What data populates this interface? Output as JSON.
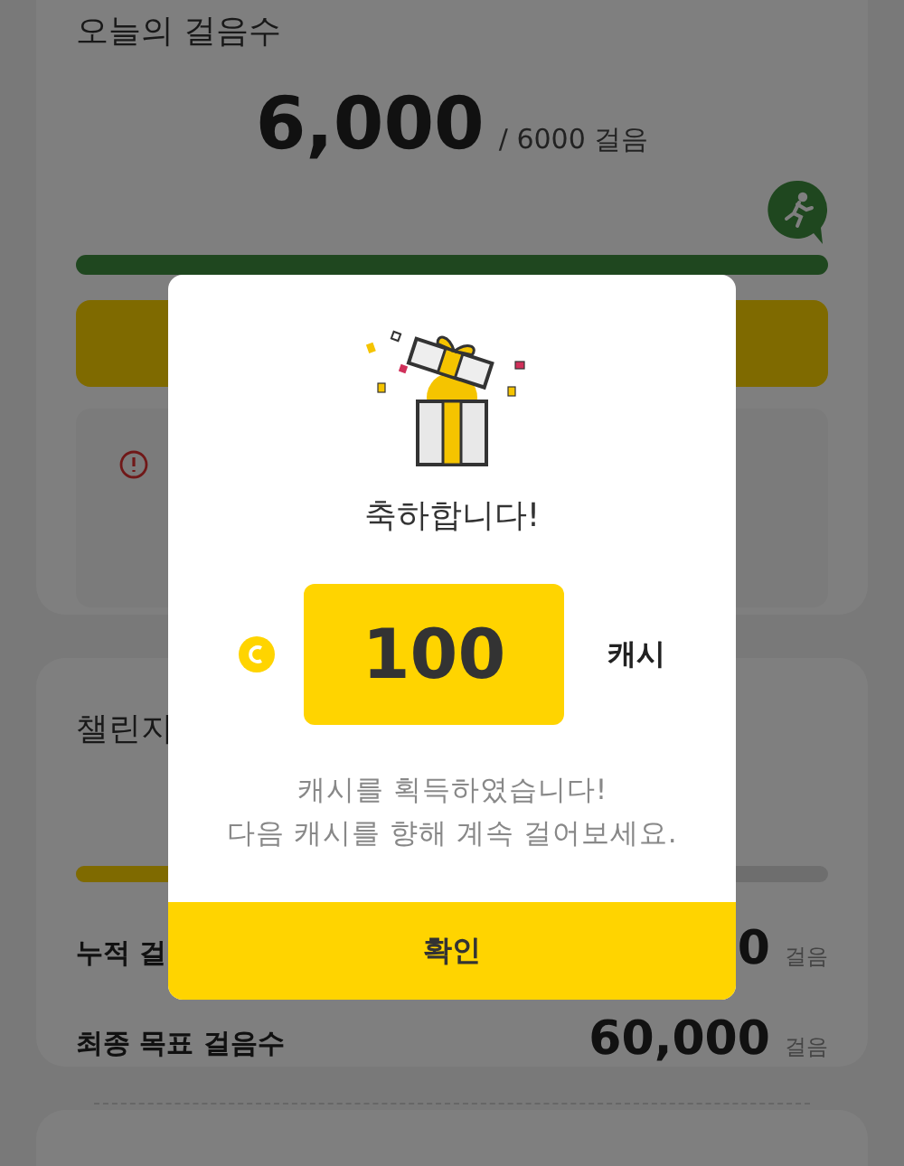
{
  "today_card": {
    "title": "오늘의 걸음수",
    "steps": "6,000",
    "goal": "/ 6000 걸음",
    "progress": {
      "level": 1
    }
  },
  "challenge_card": {
    "title": "챌린지",
    "progress": {
      "level": 0.2
    },
    "rows": [
      {
        "label": "누적 걸",
        "value": "0",
        "unit": "걸음"
      },
      {
        "label": "최종 목표 걸음수",
        "value": "60,000",
        "unit": "걸음"
      }
    ]
  },
  "reward_dialog": {
    "title": "축하합니다!",
    "amount": "100",
    "currency": "캐시",
    "message": [
      "캐시를 획득하였습니다!",
      "다음 캐시를 향해 계속 걸어보세요."
    ],
    "confirm": "확인"
  }
}
